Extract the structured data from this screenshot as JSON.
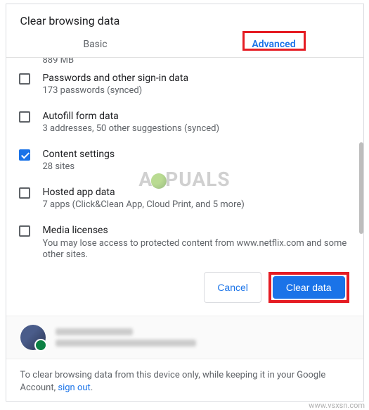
{
  "dialog": {
    "title": "Clear browsing data",
    "tabs": {
      "basic": "Basic",
      "advanced": "Advanced"
    },
    "truncated_line": "889 MB",
    "items": [
      {
        "title": "Passwords and other sign-in data",
        "sub": "173 passwords (synced)",
        "checked": false
      },
      {
        "title": "Autofill form data",
        "sub": "3 addresses, 50 other suggestions (synced)",
        "checked": false
      },
      {
        "title": "Content settings",
        "sub": "28 sites",
        "checked": true
      },
      {
        "title": "Hosted app data",
        "sub": "7 apps (Click&Clean App, Cloud Print, and 5 more)",
        "checked": false
      },
      {
        "title": "Media licenses",
        "sub": "You may lose access to protected content from www.netflix.com and some other sites.",
        "checked": false
      }
    ],
    "actions": {
      "cancel": "Cancel",
      "clear": "Clear data"
    },
    "footer": {
      "text": "To clear browsing data from this device only, while keeping it in your Google Account, ",
      "link": "sign out",
      "suffix": "."
    }
  },
  "watermark": {
    "logo_prefix": "A",
    "logo_suffix": "PUALS",
    "url": "www.vsxsn.com"
  }
}
